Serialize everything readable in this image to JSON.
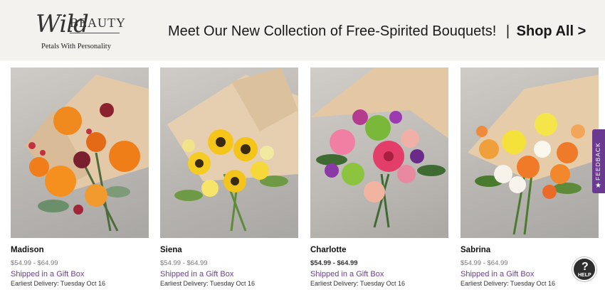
{
  "banner": {
    "logo_script": "Wild",
    "logo_word": "BEAUTY",
    "tagline": "Petals With Personality",
    "headline": "Meet Our New Collection of Free-Spirited Bouquets!",
    "separator": "|",
    "shop_all": "Shop All >"
  },
  "products": [
    {
      "name": "Madison",
      "price": "$54.99 - $64.99",
      "shipping": "Shipped in a Gift Box",
      "delivery": "Earliest Delivery: Tuesday Oct 16"
    },
    {
      "name": "Siena",
      "price": "$54.99 - $64.99",
      "shipping": "Shipped in a Gift Box",
      "delivery": "Earliest Delivery: Tuesday Oct 16"
    },
    {
      "name": "Charlotte",
      "price": "$54.99 - $64.99",
      "shipping": "Shipped in a Gift Box",
      "delivery": "Earliest Delivery: Tuesday Oct 16"
    },
    {
      "name": "Sabrina",
      "price": "$54.99 - $64.99",
      "shipping": "Shipped in a Gift Box",
      "delivery": "Earliest Delivery: Tuesday Oct 16"
    }
  ],
  "feedback_tab": {
    "label": "FEEDBACK",
    "icon": "star-icon"
  },
  "help_button": {
    "label": "HELP",
    "glyph": "?"
  },
  "colors": {
    "banner_bg": "#f4f2ef",
    "shipping_text": "#6b3f8f",
    "feedback_bg": "#6a3a91",
    "help_bg": "#2e2e2e"
  }
}
